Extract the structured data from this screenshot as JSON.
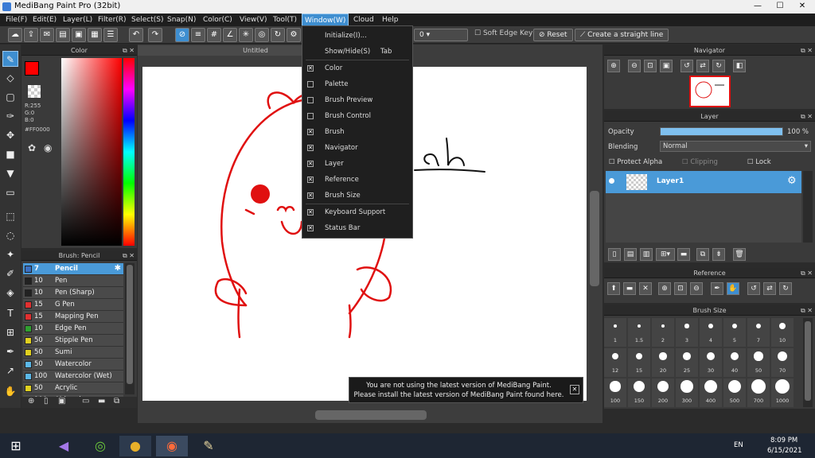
{
  "app": {
    "title": "MediBang Paint Pro (32bit)"
  },
  "window_controls": {
    "minimize": "—",
    "maximize": "☐",
    "close": "✕"
  },
  "menu": [
    "File(F)",
    "Edit(E)",
    "Layer(L)",
    "Filter(R)",
    "Select(S)",
    "Snap(N)",
    "Color(C)",
    "View(V)",
    "Tool(T)",
    "Window(W)",
    "Cloud",
    "Help"
  ],
  "toolbar": {
    "brush_size_value": "0",
    "soft_edge": "Soft Edge",
    "key": "Key",
    "reset": "Reset",
    "straight_line": "Create a straight line"
  },
  "color_panel": {
    "title": "Color",
    "r": "R:255",
    "g": "G:0",
    "b": "B:0",
    "hex": "#FF0000",
    "color_hex": "#ff0000"
  },
  "brush_panel": {
    "title": "Brush: Pencil",
    "items": [
      {
        "size": "7",
        "name": "Pencil",
        "color": "#3b6fc0",
        "selected": true
      },
      {
        "size": "10",
        "name": "Pen",
        "color": "#222222"
      },
      {
        "size": "10",
        "name": "Pen (Sharp)",
        "color": "#222222"
      },
      {
        "size": "15",
        "name": "G Pen",
        "color": "#e03030"
      },
      {
        "size": "15",
        "name": "Mapping Pen",
        "color": "#e03030"
      },
      {
        "size": "10",
        "name": "Edge Pen",
        "color": "#30a030"
      },
      {
        "size": "50",
        "name": "Stipple Pen",
        "color": "#e0d020"
      },
      {
        "size": "50",
        "name": "Sumi",
        "color": "#e0d020"
      },
      {
        "size": "50",
        "name": "Watercolor",
        "color": "#5bb8e8"
      },
      {
        "size": "100",
        "name": "Watercolor (Wet)",
        "color": "#5bb8e8"
      },
      {
        "size": "50",
        "name": "Acrylic",
        "color": "#e0d020"
      },
      {
        "size": "100",
        "name": "Airbrush",
        "color": "#aaaaaa"
      }
    ]
  },
  "document": {
    "tab": "Untitled",
    "canvas_text": "ah"
  },
  "window_menu": {
    "items": [
      {
        "label": "Initialize(I)...",
        "checkbox": false
      },
      {
        "label": "Show/Hide(S)",
        "shortcut": "Tab",
        "checkbox": false
      },
      {
        "label": "Color",
        "checked": true,
        "checkbox": true
      },
      {
        "label": "Palette",
        "checked": false,
        "checkbox": true
      },
      {
        "label": "Brush Preview",
        "checked": false,
        "checkbox": true
      },
      {
        "label": "Brush Control",
        "checked": false,
        "checkbox": true
      },
      {
        "label": "Brush",
        "checked": true,
        "checkbox": true
      },
      {
        "label": "Navigator",
        "checked": true,
        "checkbox": true
      },
      {
        "label": "Layer",
        "checked": true,
        "checkbox": true
      },
      {
        "label": "Reference",
        "checked": true,
        "checkbox": true
      },
      {
        "label": "Brush Size",
        "checked": true,
        "checkbox": true
      },
      {
        "label": "Keyboard Support",
        "checked": true,
        "checkbox": true
      },
      {
        "label": "Status Bar",
        "checked": true,
        "checkbox": true
      }
    ]
  },
  "notice": {
    "line1": "You are not using the latest version of MediBang Paint.",
    "line2": "Please install the latest version of MediBang Paint found here.",
    "close": "✕"
  },
  "navigator": {
    "title": "Navigator"
  },
  "layer_panel": {
    "title": "Layer",
    "opacity_label": "Opacity",
    "opacity_value": "100 %",
    "opacity_fraction": 1.0,
    "blending_label": "Blending",
    "blending_value": "Normal",
    "protect_alpha": "Protect Alpha",
    "clipping": "Clipping",
    "lock": "Lock",
    "layer_name": "Layer1"
  },
  "reference": {
    "title": "Reference"
  },
  "brush_size": {
    "title": "Brush Size",
    "sizes": [
      "1",
      "1.5",
      "2",
      "3",
      "4",
      "5",
      "7",
      "10",
      "12",
      "15",
      "20",
      "25",
      "30",
      "40",
      "50",
      "70",
      "100",
      "150",
      "200",
      "300",
      "400",
      "500",
      "700",
      "1000"
    ]
  },
  "taskbar": {
    "lang": "EN",
    "time": "8:09 PM",
    "date": "6/15/2021"
  }
}
